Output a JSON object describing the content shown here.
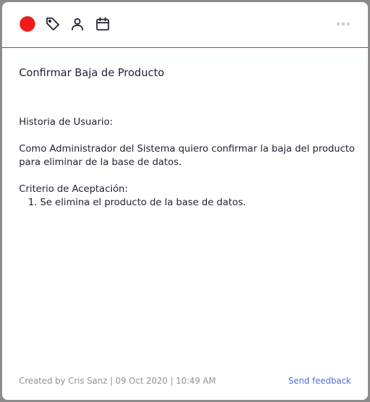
{
  "toolbar": {
    "color_dot": "#ef1b1b",
    "icons": [
      "tag-icon",
      "user-icon",
      "calendar-icon"
    ],
    "more_icon": "more-horizontal-icon",
    "divider_color": "#d9232e"
  },
  "card": {
    "title": "Confirmar Baja de Producto",
    "story_heading": "Historia de Usuario:",
    "story_line_1": "Como Administrador del Sistema quiero confirmar la baja del producto",
    "story_line_2": "para eliminar de la base de datos.",
    "criteria_heading": "Criterio de Aceptación:",
    "criteria": [
      "Se elimina el producto de la base de datos."
    ]
  },
  "footer": {
    "meta": "Created by Cris Sanz | 09 Oct 2020 | 10:49 AM",
    "feedback_link": "Send feedback"
  }
}
